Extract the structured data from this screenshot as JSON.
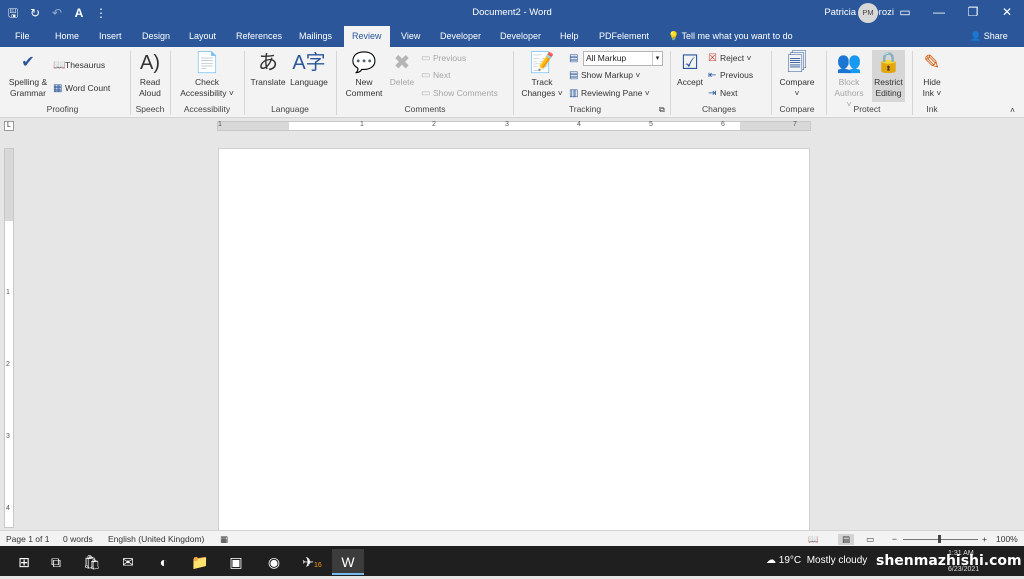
{
  "window": {
    "title": "Document2  -  Word",
    "user": "Patricia Mworozi",
    "user_initials": "PM"
  },
  "qat": {
    "save_icon": "save-icon",
    "autosave_icon": "autosave-icon",
    "undo_icon": "undo-icon",
    "font_icon": "A",
    "more": "⋮"
  },
  "tabs": [
    "File",
    "Home",
    "Insert",
    "Design",
    "Layout",
    "References",
    "Mailings",
    "Review",
    "View",
    "Developer",
    "Developer",
    "Help",
    "PDFelement"
  ],
  "active_tab": "Review",
  "tellme": "Tell me what you want to do",
  "share": "Share",
  "ribbon": {
    "proofing": {
      "spelling": "Spelling &",
      "spelling2": "Grammar",
      "thesaurus": "Thesaurus",
      "word_count": "Word Count",
      "group": "Proofing"
    },
    "speech": {
      "read_aloud": "Read",
      "read_aloud2": "Aloud",
      "group": "Speech"
    },
    "accessibility": {
      "check": "Check",
      "check2": "Accessibility ˅",
      "group": "Accessibility"
    },
    "language": {
      "translate": "Translate",
      "language": "Language",
      "group": "Language"
    },
    "comments": {
      "new": "New",
      "new2": "Comment",
      "delete": "Delete",
      "previous": "Previous",
      "next": "Next",
      "show": "Show Comments",
      "group": "Comments"
    },
    "tracking": {
      "track": "Track",
      "track2": "Changes ˅",
      "markup": "All Markup",
      "show_markup": "Show Markup ˅",
      "reviewing_pane": "Reviewing Pane ˅",
      "group": "Tracking"
    },
    "changes": {
      "accept": "Accept",
      "reject": "Reject ˅",
      "previous": "Previous",
      "next": "Next",
      "group": "Changes"
    },
    "compare": {
      "compare": "Compare",
      "group": "Compare"
    },
    "protect": {
      "block": "Block",
      "block2": "Authors ˅",
      "restrict": "Restrict",
      "restrict2": "Editing",
      "group": "Protect"
    },
    "ink": {
      "hide": "Hide",
      "hide2": "Ink ˅",
      "group": "Ink"
    }
  },
  "ruler": {
    "h_numbers": [
      "1",
      "1",
      "2",
      "3",
      "4",
      "5",
      "6",
      "7"
    ],
    "v_numbers": [
      "1",
      "2",
      "3",
      "4"
    ]
  },
  "status": {
    "page": "Page 1 of 1",
    "words": "0 words",
    "language": "English (United Kingdom)",
    "zoom": "100%",
    "zoom_minus": "−",
    "zoom_plus": "+"
  },
  "taskbar": {
    "weather_temp": "19°C",
    "weather_text": "Mostly cloudy",
    "time": "1:31 AM",
    "date": "6/23/2021",
    "chrome_badge": "16"
  },
  "watermark": "shenmazhishi.com"
}
